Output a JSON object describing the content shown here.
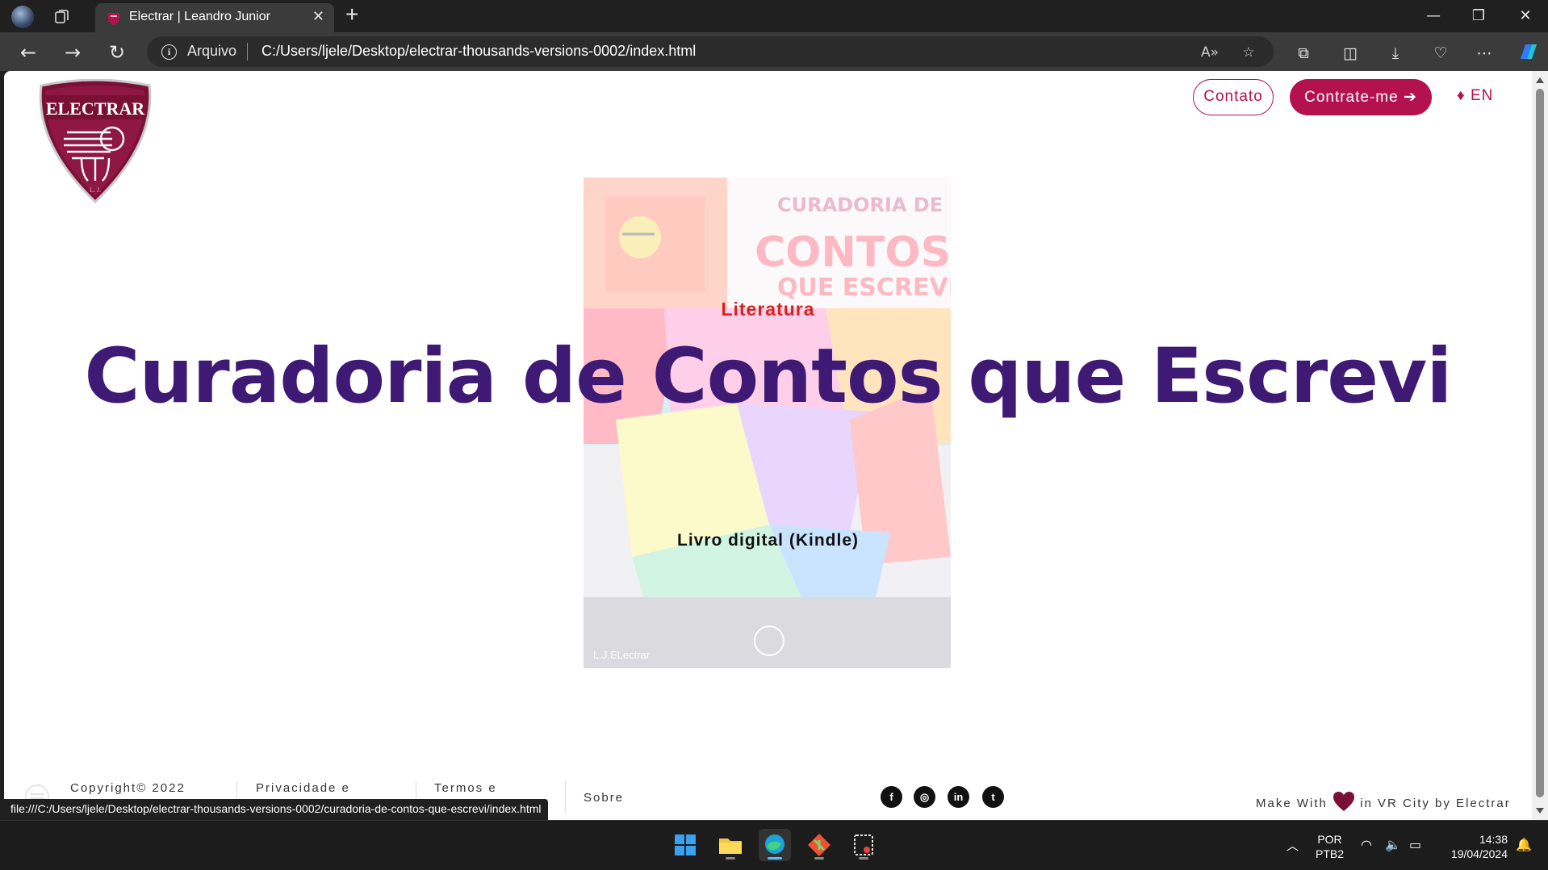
{
  "browser": {
    "tab_title": "Electrar | Leandro Junior",
    "address_prefix": "Arquivo",
    "url": "C:/Users/ljele/Desktop/electrar-thousands-versions-0002/index.html",
    "status_url": "file:///C:/Users/ljele/Desktop/electrar-thousands-versions-0002/curadoria-de-contos-que-escrevi/index.html"
  },
  "header": {
    "logo_text": "ELECTRAR",
    "contact_label": "Contato",
    "hire_label": "Contrate-me ➔",
    "lang_label": "♦ EN"
  },
  "hero": {
    "category": "Literatura",
    "title": "Curadoria de Contos que Escrevi",
    "subtitle": "Livro digital (Kindle)"
  },
  "cover": {
    "title_line1": "CURADORIA DE",
    "title_line2": "CONTOS",
    "title_line3": "QUE ESCREVI",
    "author": "L.J.ELectrar"
  },
  "footer": {
    "copyright": "Copyright© 2022",
    "privacy": "Privacidade e",
    "terms": "Termos e",
    "about": "Sobre",
    "made_with_prefix": "Make With",
    "made_with_suffix": "in VR City by Electrar"
  },
  "taskbar": {
    "lang_line1": "POR",
    "lang_line2": "PTB2",
    "time": "14:38",
    "date": "19/04/2024"
  },
  "colors": {
    "brand": "#b3124f",
    "title": "#3f1a74",
    "category": "#d7211f"
  }
}
